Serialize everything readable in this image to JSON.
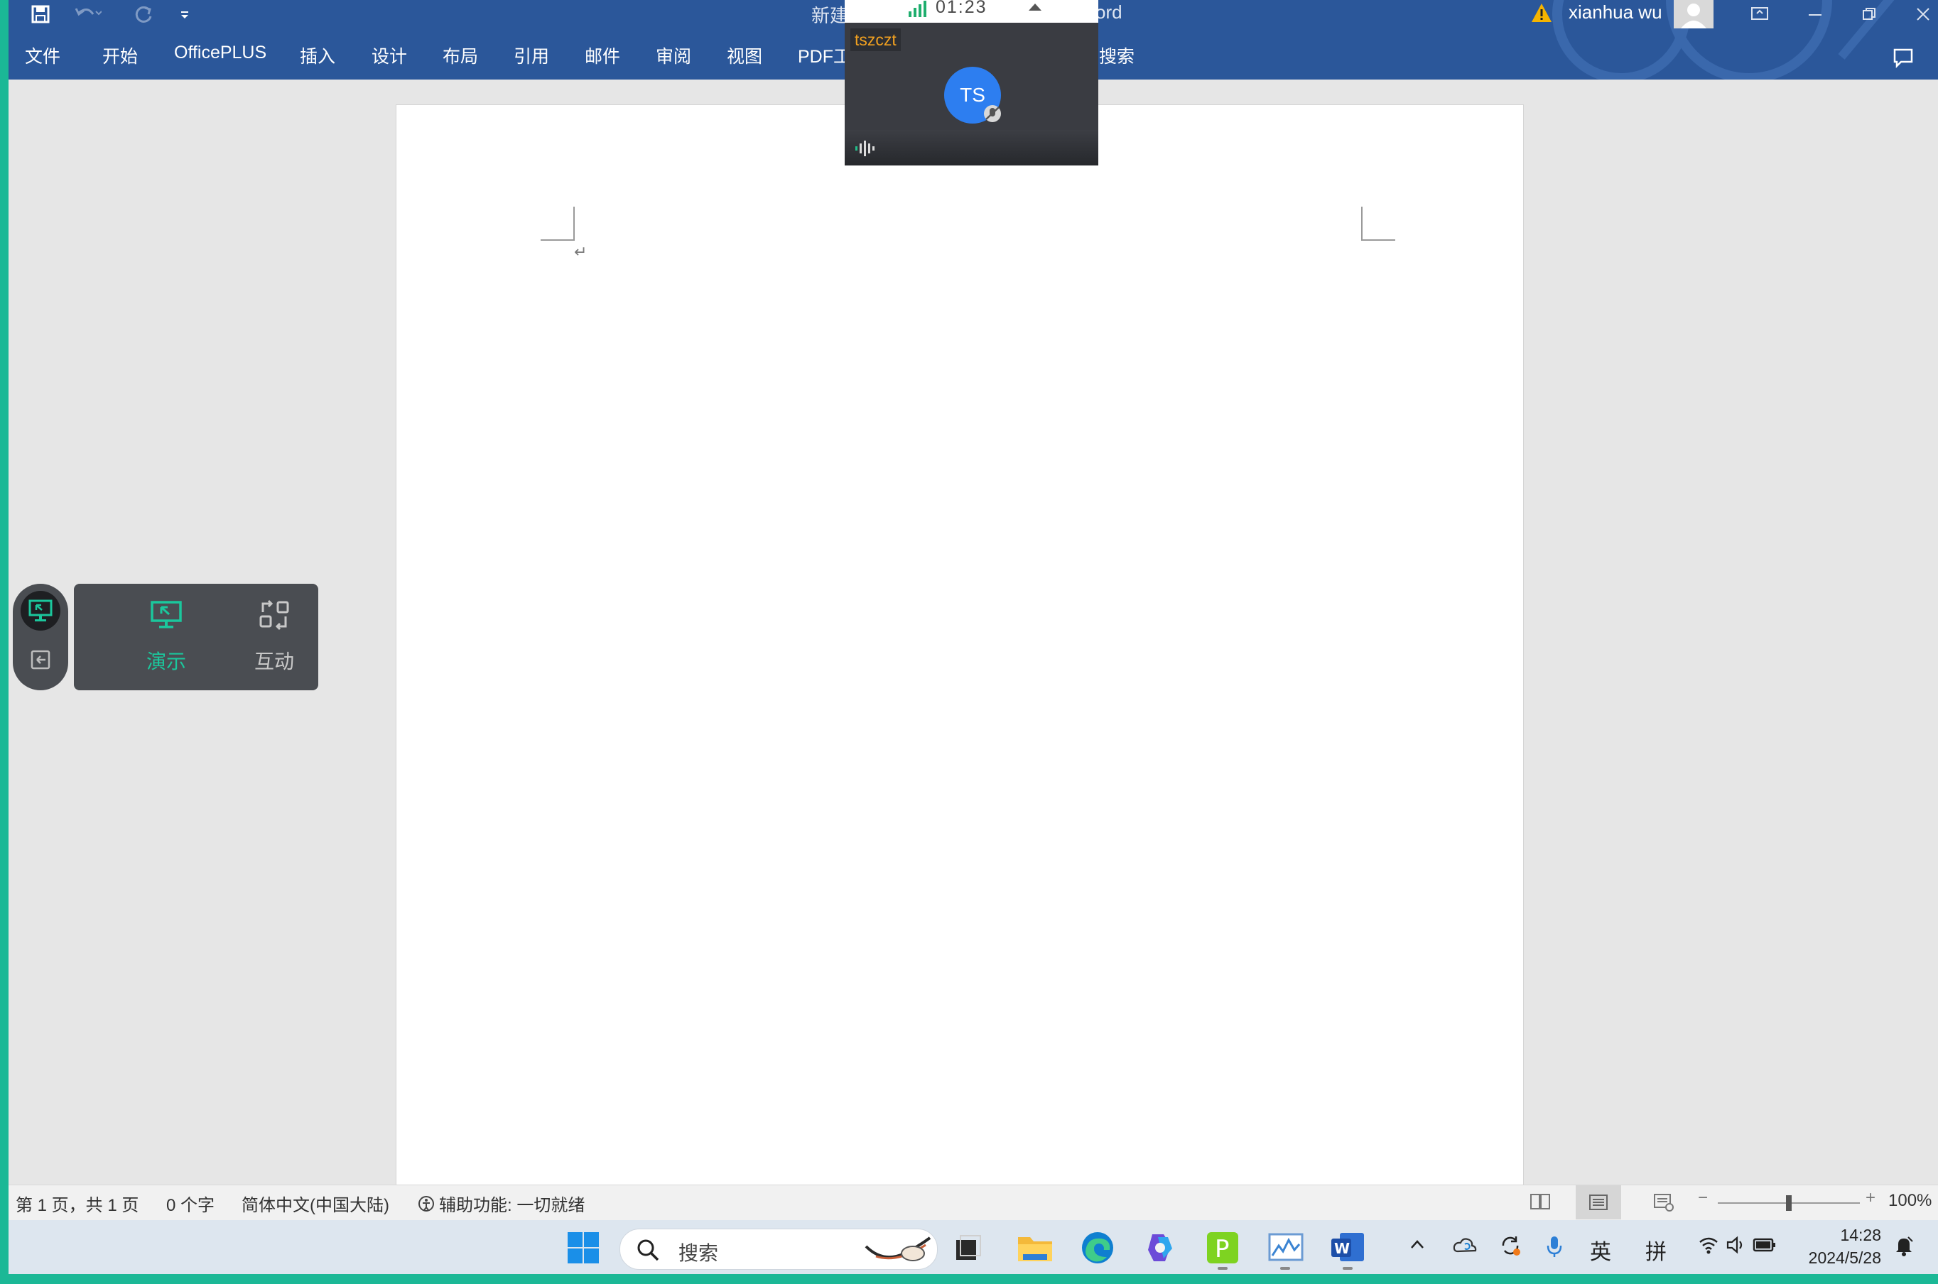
{
  "titlebar": {
    "doc_title_start": "新建",
    "doc_title_end": "ord",
    "user_name": "xianhua wu"
  },
  "ribbon": {
    "tabs": [
      "文件",
      "开始",
      "OfficePLUS",
      "插入",
      "设计",
      "布局",
      "引用",
      "邮件",
      "审阅",
      "视图",
      "PDF工",
      "搜索"
    ]
  },
  "meeting": {
    "timer": "01:23",
    "user_name": "tszczt",
    "avatar_initials": "TS"
  },
  "float_toolbar": {
    "present_label": "演示",
    "interact_label": "互动"
  },
  "statusbar": {
    "page_info": "第 1 页，共 1 页",
    "word_count": "0 个字",
    "language": "简体中文(中国大陆)",
    "accessibility": "辅助功能: 一切就绪",
    "zoom_minus": "−",
    "zoom_plus": "+",
    "zoom_level": "100%",
    "zoom_fraction": 0.5
  },
  "taskbar": {
    "search_label": "搜索",
    "tray_ime_lang": "英",
    "tray_ime_mode": "拼",
    "time": "14:28",
    "date": "2024/5/28"
  },
  "colors": {
    "ribbon_blue": "#2b579a",
    "accent_green": "#1bb896",
    "meeting_user": "#f0a020",
    "avatar_blue": "#2d7ef0"
  }
}
